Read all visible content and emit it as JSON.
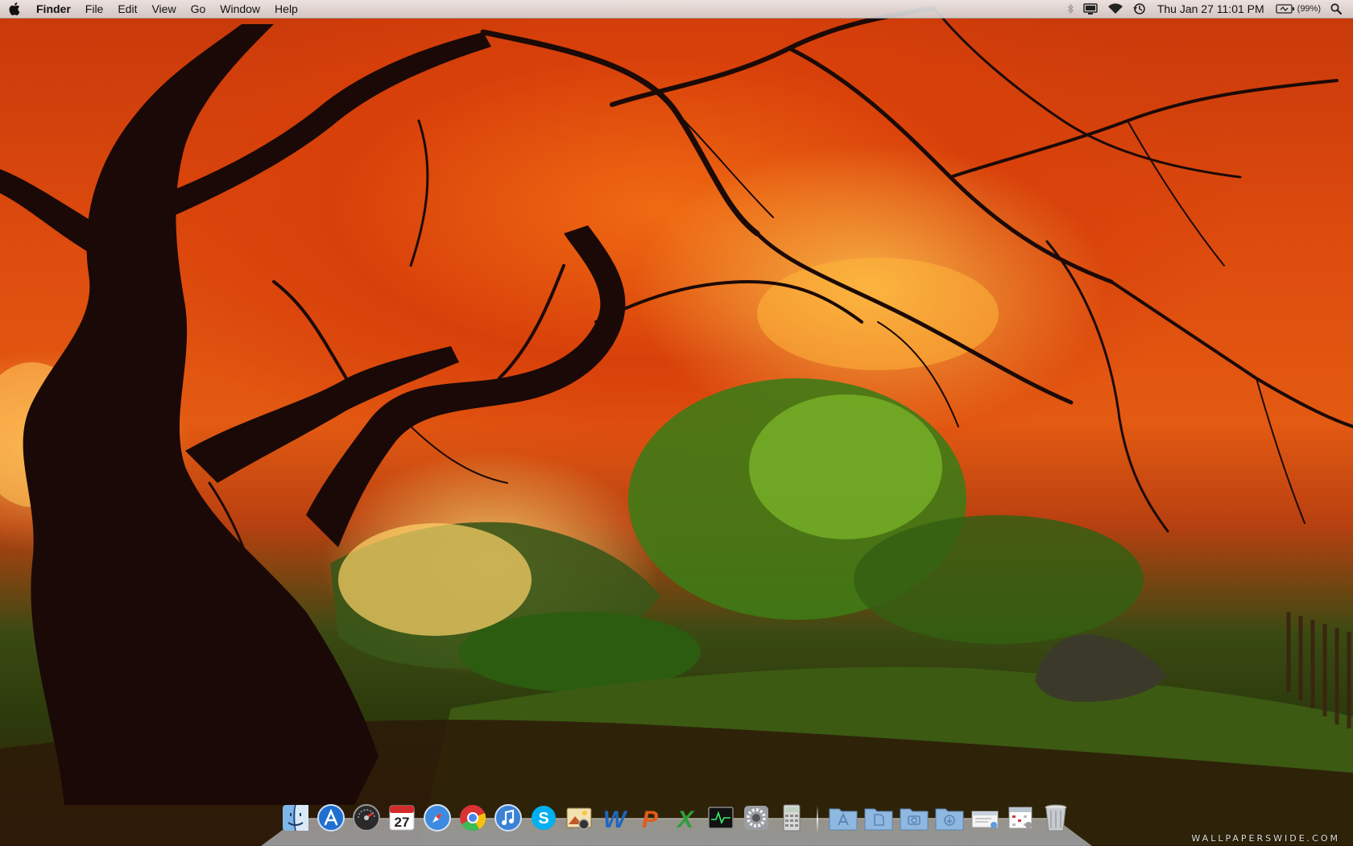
{
  "menubar": {
    "app_name": "Finder",
    "menus": [
      "File",
      "Edit",
      "View",
      "Go",
      "Window",
      "Help"
    ],
    "clock": "Thu Jan 27  11:01 PM",
    "battery_percent": "(99%)"
  },
  "status_icons": [
    "bluetooth-icon",
    "display-icon",
    "wifi-icon",
    "time-machine-icon",
    "battery-icon",
    "spotlight-icon"
  ],
  "dock": {
    "apps": [
      "finder",
      "app-store",
      "dashboard",
      "ical",
      "safari",
      "chrome",
      "itunes",
      "skype",
      "iphoto",
      "word",
      "powerpoint",
      "excel",
      "activity-monitor",
      "system-preferences",
      "calculator"
    ],
    "ical_date": "27",
    "folders": [
      "applications",
      "documents",
      "pictures",
      "downloads",
      "mail-preview",
      "calendar-preview",
      "trash"
    ]
  },
  "colors": {
    "foliage": "#e0480c",
    "trunk": "#1a0a06",
    "menubar": "#e2e2e2"
  },
  "wallpaper_watermark": "WALLPAPERSWIDE.COM"
}
